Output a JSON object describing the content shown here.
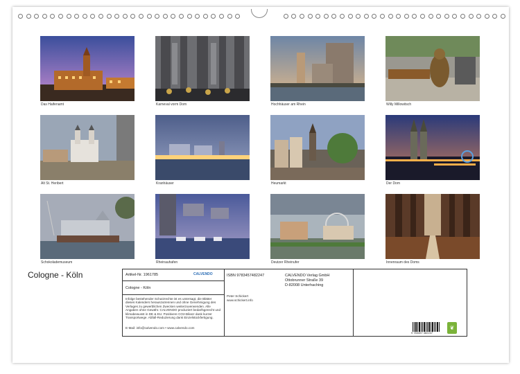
{
  "photos": [
    {
      "caption": "Das Haifenamt"
    },
    {
      "caption": "Karneval vorm Dom"
    },
    {
      "caption": "Hochhäuser am Rhein"
    },
    {
      "caption": "Willy Millowitsch"
    },
    {
      "caption": "Alt St. Heribert"
    },
    {
      "caption": "Kranhäuser"
    },
    {
      "caption": "Heumarkt"
    },
    {
      "caption": "Der Dom"
    },
    {
      "caption": "Schokolademuseum"
    },
    {
      "caption": "Rheinauhafen"
    },
    {
      "caption": "Deutzer Rheinufer"
    },
    {
      "caption": "Innenraum des Doms"
    }
  ],
  "title": "Cologne - Köln",
  "info": {
    "article": "Artikel-Nr. 1961785",
    "brand": "CALVENDO",
    "name": "Cologne - Köln",
    "isbn": "ISBN 9783457482247",
    "author": "Peter Schickert",
    "website": "www.schickert.info",
    "publisher_line1": "CALVENDO Verlag GmbH",
    "publisher_line2": "Ottobrunner Straße 39",
    "publisher_line3": "D-82008 Unterhaching",
    "legal": "Infolge bestehender Schutzrechte ist es untersagt, die Blätter dieses Kalenders herauszutrennen und ohne Genehmigung des Verlages zu gewerblichen Zwecken weiterzuverwenden. Alle Angaben ohne Gewähr. CALVENDO produziert bedarfsgerecht und klimabewusst in DE & EU. Positivere CO2-Bilanz dank kurzer Transportwege. Abfall-Reduzierung dank Einzelstückfertigung.",
    "email": "E-Mail: info@calvendo.com • www.calvendo.com",
    "barcode_number": "9 783457 482247"
  }
}
